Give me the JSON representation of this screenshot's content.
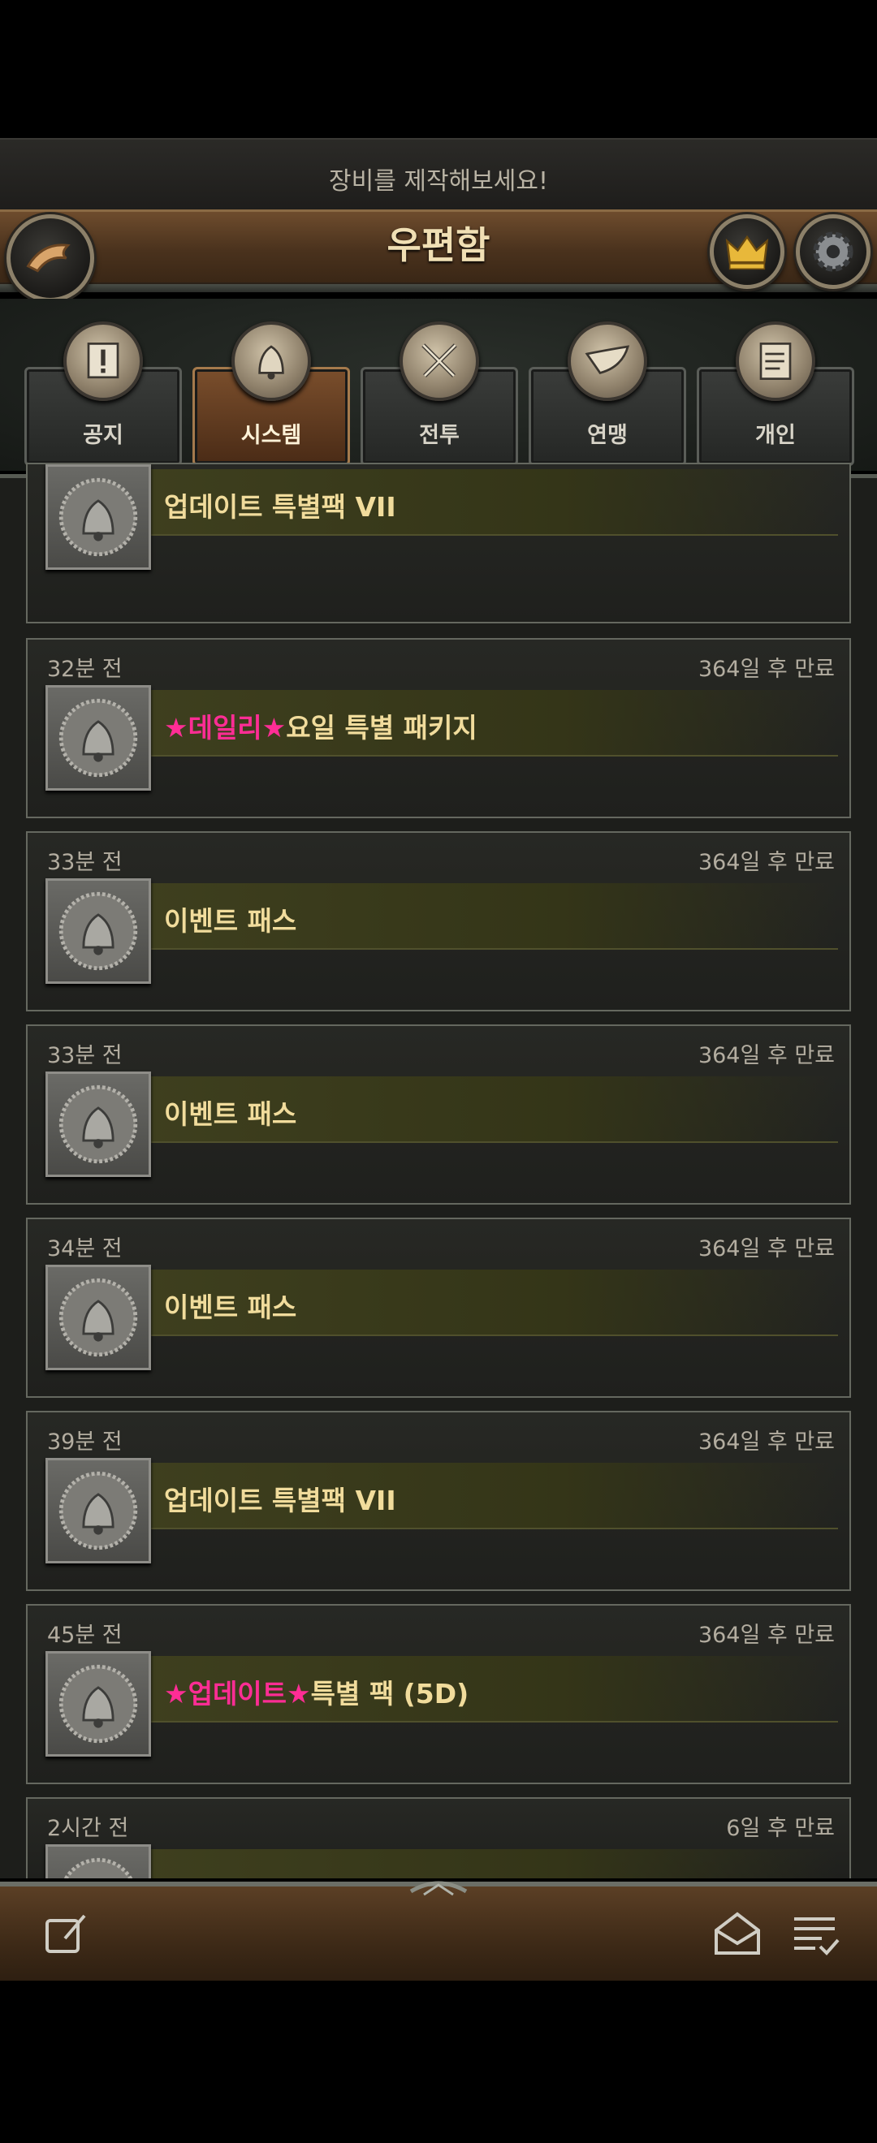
{
  "banner": {
    "message": "장비를 제작해보세요!"
  },
  "header": {
    "title": "우편함"
  },
  "tabs": [
    {
      "label": "공지",
      "icon": "notice-icon",
      "active": false
    },
    {
      "label": "시스템",
      "icon": "bell-icon",
      "active": true
    },
    {
      "label": "전투",
      "icon": "crossed-swords-icon",
      "active": false
    },
    {
      "label": "연맹",
      "icon": "horn-icon",
      "active": false
    },
    {
      "label": "개인",
      "icon": "letter-icon",
      "active": false
    }
  ],
  "mails": [
    {
      "time": "",
      "expire": "",
      "subject_star": "",
      "subject": "업데이트 특별팩 VII"
    },
    {
      "time": "32분 전",
      "expire": "364일 후 만료",
      "subject_star": "★데일리★",
      "subject": "요일 특별 패키지"
    },
    {
      "time": "33분 전",
      "expire": "364일 후 만료",
      "subject_star": "",
      "subject": "이벤트 패스"
    },
    {
      "time": "33분 전",
      "expire": "364일 후 만료",
      "subject_star": "",
      "subject": "이벤트 패스"
    },
    {
      "time": "34분 전",
      "expire": "364일 후 만료",
      "subject_star": "",
      "subject": "이벤트 패스"
    },
    {
      "time": "39분 전",
      "expire": "364일 후 만료",
      "subject_star": "",
      "subject": "업데이트 특별팩 VII"
    },
    {
      "time": "45분 전",
      "expire": "364일 후 만료",
      "subject_star": "★업데이트★",
      "subject": "특별 팩 (5D)"
    },
    {
      "time": "2시간 전",
      "expire": "6일 후 만료",
      "subject_star": "",
      "subject": ""
    }
  ],
  "colors": {
    "accent_star": "#ff2d95",
    "subject_text": "#f1dc9c",
    "title_text": "#f0dfb4"
  },
  "bottom_bar": {
    "icons": [
      "compose-icon",
      "open-envelope-icon",
      "checklist-icon"
    ]
  }
}
